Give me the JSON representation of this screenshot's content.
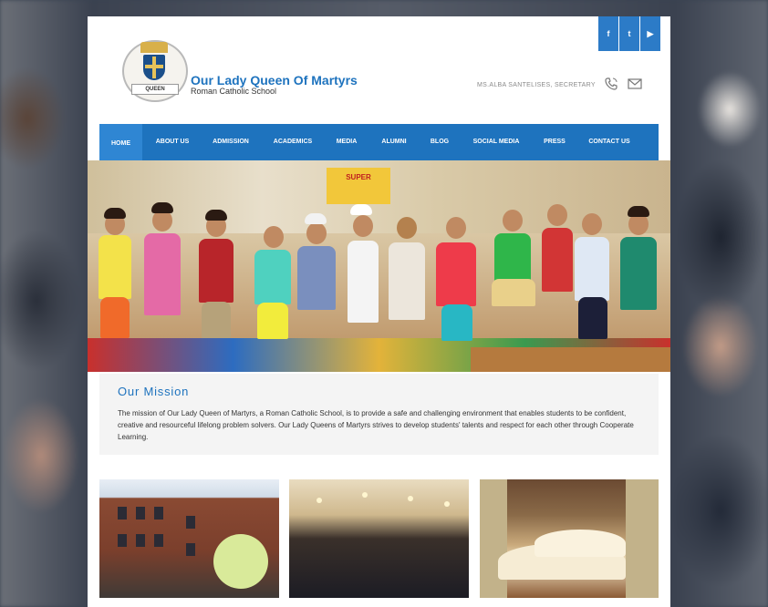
{
  "header": {
    "school_name": "Our Lady Queen Of Martyrs",
    "school_subtitle": "Roman Catholic School",
    "contact_text": "MS.ALBA SANTELISES, SECRETARY",
    "logo_text": "QUEEN",
    "social": [
      {
        "icon": "facebook-icon",
        "glyph": "f"
      },
      {
        "icon": "twitter-icon",
        "glyph": "t"
      },
      {
        "icon": "youtube-icon",
        "glyph": "▶"
      }
    ]
  },
  "nav": {
    "items": [
      "HOME",
      "ABOUT US",
      "ADMISSION",
      "ACADEMICS",
      "MEDIA",
      "ALUMNI",
      "BLOG",
      "SOCIAL MEDIA",
      "PRESS",
      "CONTACT US"
    ],
    "active": "HOME"
  },
  "mission": {
    "title": "Our Mission",
    "text": "The mission of Our Lady Queen of Martyrs, a Roman Catholic School, is to provide a safe and challenging environment that enables students to be confident, creative and resourceful lifelong problem solvers. Our Lady Queens of Martyrs strives to develop students' talents and respect for each other through Cooperate Learning."
  },
  "hero": {
    "poster_text": "SUPER"
  },
  "colors": {
    "brand_blue": "#1e73be",
    "nav_active": "#2f86d3",
    "mission_bg": "#f4f4f4"
  }
}
